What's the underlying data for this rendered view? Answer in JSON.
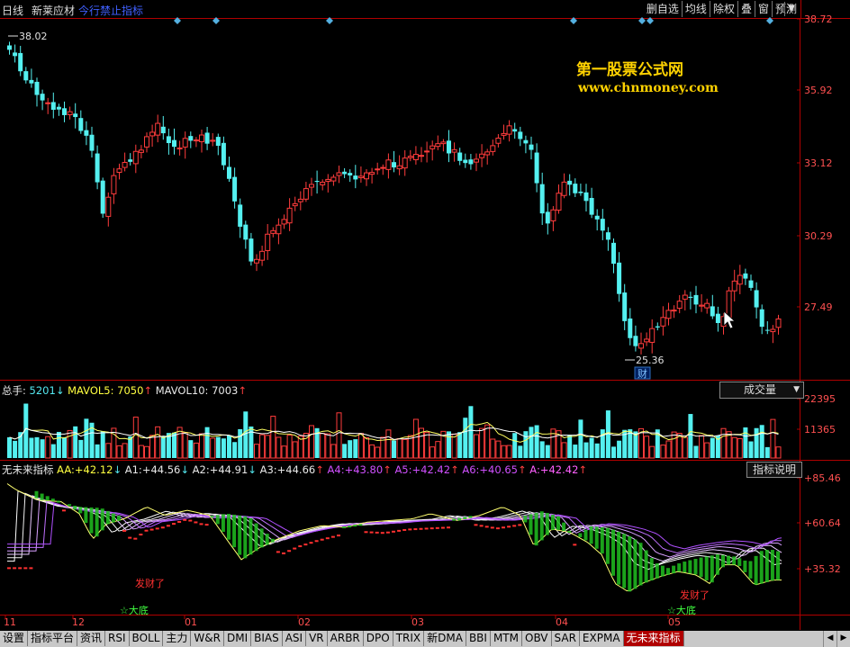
{
  "topbar": {
    "period": "日线",
    "stock_name": "新莱应材",
    "warning": "今行禁止指标",
    "buttons": [
      "删自选",
      "均线",
      "除权",
      "叠",
      "窗",
      "预测"
    ]
  },
  "watermark": {
    "line1": "第一股票公式网",
    "line2": "www.chnmoney.com"
  },
  "price_panel": {
    "y_labels": [
      "38.72",
      "35.92",
      "33.12",
      "30.29",
      "27.49"
    ],
    "high_label": "38.02",
    "low_label": "25.36",
    "marker": "财"
  },
  "volume_panel": {
    "label": "总手:",
    "value": "5201",
    "value_arrow": "↓",
    "ma5_label": "MAVOL5:",
    "ma5_value": "7050",
    "ma5_arrow": "↑",
    "ma10_label": "MAVOL10:",
    "ma10_value": "7003",
    "ma10_arrow": "↑",
    "selector": "成交量",
    "y_labels": [
      "22395",
      "11365"
    ]
  },
  "indicator_panel": {
    "name": "无未来指标",
    "values": [
      {
        "label": "AA:",
        "value": "+42.12",
        "arrow": "↓",
        "cls": "y"
      },
      {
        "label": "A1:",
        "value": "+44.56",
        "arrow": "↓",
        "cls": "w"
      },
      {
        "label": "A2:",
        "value": "+44.91",
        "arrow": "↓",
        "cls": "w"
      },
      {
        "label": "A3:",
        "value": "+44.66",
        "arrow": "↑",
        "cls": "w"
      },
      {
        "label": "A4:",
        "value": "+43.80",
        "arrow": "↑",
        "cls": "m"
      },
      {
        "label": "A5:",
        "value": "+42.42",
        "arrow": "↑",
        "cls": "m"
      },
      {
        "label": "A6:",
        "value": "+40.65",
        "arrow": "↑",
        "cls": "m"
      },
      {
        "label": "A:",
        "value": "+42.42",
        "arrow": "↑",
        "cls": "p"
      }
    ],
    "explain_button": "指标说明",
    "y_labels": [
      "+85.46",
      "+60.64",
      "+35.32"
    ],
    "annotations": [
      "发财了",
      "☆大底",
      "发财了",
      "☆大底"
    ]
  },
  "x_axis": {
    "months": [
      "11",
      "12",
      "01",
      "02",
      "03",
      "04",
      "05"
    ]
  },
  "tabs": [
    "设置",
    "指标平台",
    "资讯",
    "RSI",
    "BOLL",
    "主力",
    "W&R",
    "DMI",
    "BIAS",
    "ASI",
    "VR",
    "ARBR",
    "DPO",
    "TRIX",
    "新DMA",
    "BBI",
    "MTM",
    "OBV",
    "SAR",
    "EXPMA",
    "无未来指标"
  ],
  "active_tab": "无未来指标",
  "colors": {
    "up": "#ff3c3c",
    "down": "#54f0f0",
    "axis": "#b00000",
    "bg": "#000000"
  }
}
